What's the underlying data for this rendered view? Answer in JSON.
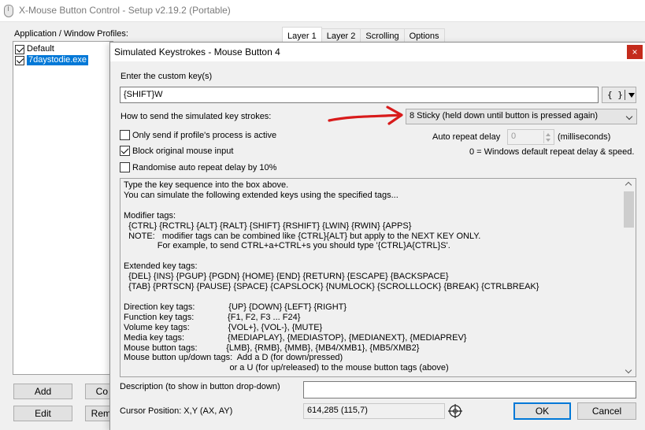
{
  "main_window": {
    "title": "X-Mouse Button Control - Setup v2.19.2 (Portable)",
    "profiles_label": "Application / Window Profiles:",
    "profiles": [
      {
        "name": "Default",
        "checked": true,
        "selected": false
      },
      {
        "name": "7daystodie.exe",
        "checked": true,
        "selected": true
      }
    ],
    "tabs": [
      {
        "label": "Layer 1",
        "active": true
      },
      {
        "label": "Layer 2",
        "active": false
      },
      {
        "label": "Scrolling",
        "active": false
      },
      {
        "label": "Options",
        "active": false
      }
    ],
    "buttons": {
      "add": "Add",
      "copy_partial": "Co",
      "edit": "Edit",
      "remove_partial": "Rem"
    }
  },
  "dialog": {
    "title": "Simulated Keystrokes - Mouse Button 4",
    "close_glyph": "×",
    "custom_key_label": "Enter the custom key(s)",
    "custom_key_value": "{SHIFT}W",
    "tag_button_label": "{ }",
    "send_mode_label": "How to send the simulated key strokes:",
    "send_mode_value": "8 Sticky (held down until button is pressed again)",
    "options": {
      "only_send_active": {
        "label": "Only send if profile's process is active",
        "checked": false
      },
      "block_original": {
        "label": "Block original mouse input",
        "checked": true
      },
      "randomise_delay": {
        "label": "Randomise auto repeat delay by 10%",
        "checked": false
      }
    },
    "auto_repeat": {
      "label": "Auto repeat delay",
      "value": "0",
      "unit": "(milliseconds)",
      "hint": "0 = Windows default repeat delay & speed."
    },
    "help_text": "Type the key sequence into the box above.\nYou can simulate the following extended keys using the specified tags...\n\nModifier tags:\n  {CTRL} {RCTRL} {ALT} {RALT} {SHIFT} {RSHIFT} {LWIN} {RWIN} {APPS}\n  NOTE:   modifier tags can be combined like {CTRL}{ALT} but apply to the NEXT KEY ONLY.\n              For example, to send CTRL+a+CTRL+s you should type '{CTRL}A{CTRL}S'.\n\nExtended key tags:\n  {DEL} {INS} {PGUP} {PGDN} {HOME} {END} {RETURN} {ESCAPE} {BACKSPACE}\n  {TAB} {PRTSCN} {PAUSE} {SPACE} {CAPSLOCK} {NUMLOCK} {SCROLLLOCK} {BREAK} {CTRLBREAK}\n\nDirection key tags:              {UP} {DOWN} {LEFT} {RIGHT}\nFunction key tags:              {F1, F2, F3 ... F24}\nVolume key tags:                {VOL+}, {VOL-}, {MUTE}\nMedia key tags:                  {MEDIAPLAY}, {MEDIASTOP}, {MEDIANEXT}, {MEDIAPREV}\nMouse button tags:            {LMB}, {RMB}, {MMB}, {MB4/XMB1}, {MB5/XMB2}\nMouse button up/down tags:  Add a D (for down/pressed)\n                                            or a U (for up/released) to the mouse button tags (above)",
    "description_label": "Description (to show in button drop-down)",
    "description_value": "",
    "cursor_label": "Cursor Position: X,Y (AX, AY)",
    "cursor_value": "614,285 (115,7)",
    "ok_label": "OK",
    "cancel_label": "Cancel"
  },
  "colors": {
    "selection": "#0078d7",
    "close_button": "#c42b1c",
    "annotation_arrow": "#d81b1b"
  }
}
